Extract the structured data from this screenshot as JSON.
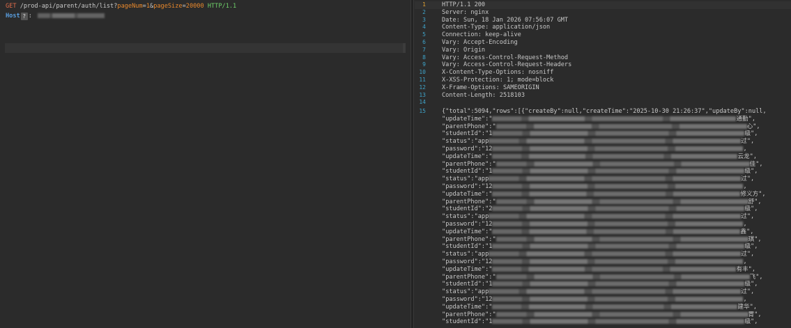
{
  "request": {
    "method": "GET",
    "path": " /prod-api/parent/auth/list?",
    "param1_name": "pageNum",
    "param1_eq": "=",
    "param1_value": "1",
    "amp": "&",
    "param2_name": "pageSize",
    "param2_eq": "=",
    "param2_value": "20000",
    "protocol": " HTTP/1.1",
    "host_label": "Host",
    "help_badge": "?",
    "host_colon": ": "
  },
  "response": {
    "line_numbers": [
      "1",
      "2",
      "3",
      "4",
      "5",
      "6",
      "7",
      "8",
      "9",
      "10",
      "11",
      "12",
      "13",
      "14",
      "15"
    ],
    "headers": [
      "HTTP/1.1 200",
      "Server: nginx",
      "Date: Sun, 18 Jan 2026 07:56:07 GMT",
      "Content-Type: application/json",
      "Connection: keep-alive",
      "Vary: Accept-Encoding",
      "Vary: Origin",
      "Vary: Access-Control-Request-Method",
      "Vary: Access-Control-Request-Headers",
      "X-Content-Type-Options: nosniff",
      "X-XSS-Protection: 1; mode=block",
      "X-Frame-Options: SAMEORIGIN",
      "Content-Length: 2518103",
      ""
    ],
    "json_first_line": "{\"total\":5094,\"rows\":[{\"createBy\":null,\"createTime\":\"2025-10-30 21:26:37\",\"updateBy\":null,",
    "json_rows": [
      {
        "prefix": "updateTime\":\"",
        "tail": "通勤\","
      },
      {
        "prefix": "parentPhone\":\"",
        "tail": "心\","
      },
      {
        "prefix": "studentId\":\"1",
        "tail": "级\","
      },
      {
        "prefix": "status\":\"app",
        "tail": "过\","
      },
      {
        "prefix": "password\":\"12",
        "tail": ","
      },
      {
        "prefix": "updateTime\":\"",
        "tail": "云龙\","
      },
      {
        "prefix": "parentPhone\":\"",
        "tail": "佳\","
      },
      {
        "prefix": "studentId\":\"1",
        "tail": "级\","
      },
      {
        "prefix": "status\":\"app",
        "tail": "过\","
      },
      {
        "prefix": "password\":\"12",
        "tail": ","
      },
      {
        "prefix": "updateTime\":\"",
        "tail": "修义方\","
      },
      {
        "prefix": "parentPhone\":\"",
        "tail": "舒\","
      },
      {
        "prefix": "studentId\":\"2",
        "tail": "级\","
      },
      {
        "prefix": "status\":\"app",
        "tail": "过\","
      },
      {
        "prefix": "password\":\"12",
        "tail": ","
      },
      {
        "prefix": "updateTime\":\"",
        "tail": "鑫\","
      },
      {
        "prefix": "parentPhone\":\"",
        "tail": "琪\","
      },
      {
        "prefix": "studentId\":\"1",
        "tail": "级\","
      },
      {
        "prefix": "status\":\"app",
        "tail": "过\","
      },
      {
        "prefix": "password\":\"12",
        "tail": ","
      },
      {
        "prefix": "updateTime\":\"",
        "tail": "有丰\","
      },
      {
        "prefix": "parentPhone\":\"",
        "tail": "飞\","
      },
      {
        "prefix": "studentId\":\"1",
        "tail": "级\","
      },
      {
        "prefix": "status\":\"app",
        "tail": "过\","
      },
      {
        "prefix": "password\":\"12",
        "tail": ","
      },
      {
        "prefix": "updateTime\":\"",
        "tail": "建华\","
      },
      {
        "prefix": "parentPhone\":\"",
        "tail": "胃\","
      },
      {
        "prefix": "studentId\":\"1",
        "tail": "级\","
      }
    ]
  }
}
